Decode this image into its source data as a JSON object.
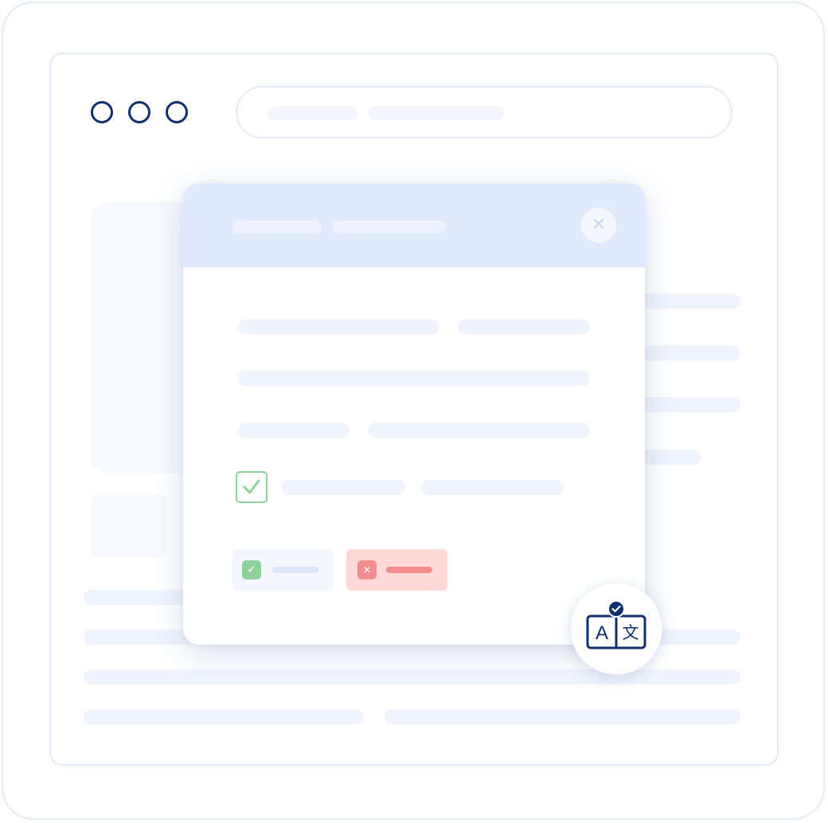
{
  "window": {
    "controls": [
      "window-dot",
      "window-dot",
      "window-dot"
    ]
  },
  "address_bar": {
    "value": ""
  },
  "dialog": {
    "title": "",
    "close_icon": "✕",
    "checkbox": {
      "checked": true,
      "check_glyph": "✓"
    },
    "accept_button": {
      "icon": "✓",
      "label": ""
    },
    "reject_button": {
      "icon": "✕",
      "label": ""
    }
  },
  "translate_badge": {
    "icon": "translate-icon",
    "glyph_latin": "A",
    "glyph_cjk": "文"
  },
  "colors": {
    "accent_navy": "#0f2f6e",
    "header_blue": "#e0eafc",
    "success_green": "#8fd19b",
    "danger_red": "#f28e8e",
    "placeholder": "#f0f4fd"
  }
}
